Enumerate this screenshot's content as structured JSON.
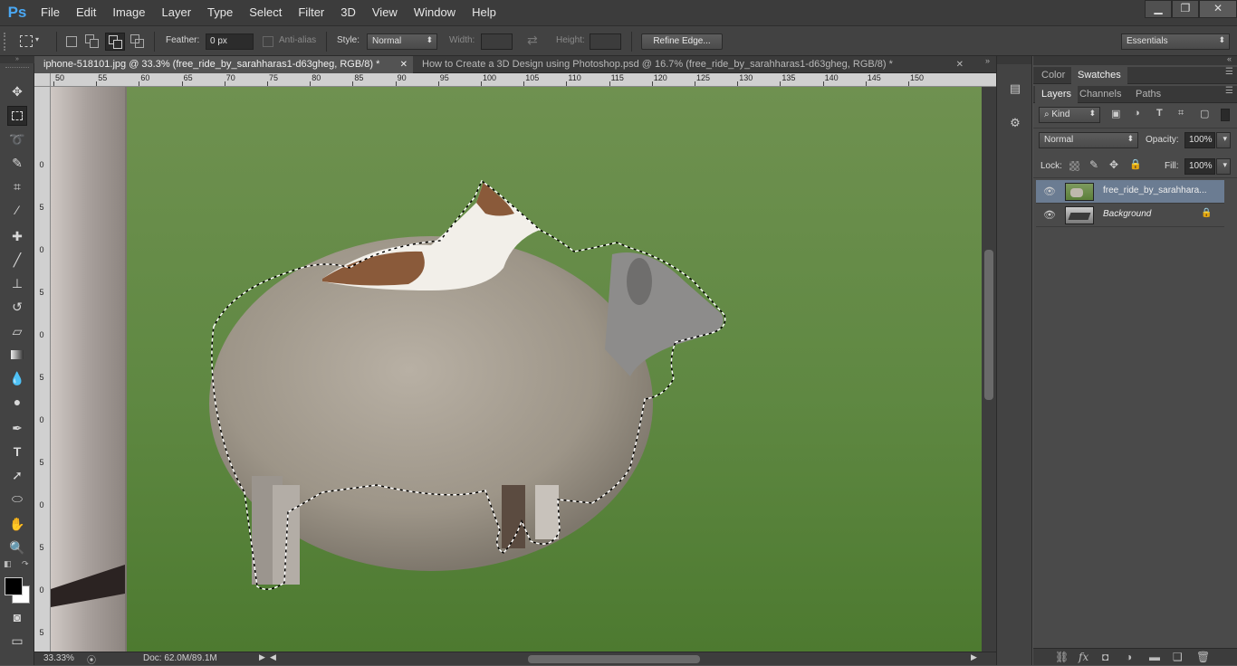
{
  "app": {
    "logo": "Ps"
  },
  "menu": [
    "File",
    "Edit",
    "Image",
    "Layer",
    "Type",
    "Select",
    "Filter",
    "3D",
    "View",
    "Window",
    "Help"
  ],
  "window_controls": {
    "minimize": "▁",
    "restore": "❐",
    "close": "✕"
  },
  "options": {
    "feather_label": "Feather:",
    "feather_value": "0 px",
    "antialias_label": "Anti-alias",
    "style_label": "Style:",
    "style_value": "Normal",
    "width_label": "Width:",
    "height_label": "Height:",
    "refine_edge_label": "Refine Edge...",
    "workspace_value": "Essentials"
  },
  "annotation": {
    "arrow_color": "#e01010"
  },
  "tabs": [
    {
      "title": "iphone-518101.jpg @ 33.3% (free_ride_by_sarahharas1-d63gheg, RGB/8) *",
      "active": true
    },
    {
      "title": "How to Create a 3D Design using Photoshop.psd @ 16.7% (free_ride_by_sarahharas1-d63gheg, RGB/8) *",
      "active": false
    }
  ],
  "ruler_h": [
    "50",
    "55",
    "60",
    "65",
    "70",
    "75",
    "80",
    "85",
    "90",
    "95",
    "100",
    "105",
    "110",
    "115",
    "120",
    "125",
    "130",
    "135",
    "140",
    "145",
    "150"
  ],
  "ruler_v": [
    "0",
    "5",
    "0",
    "5",
    "0",
    "5",
    "0",
    "5",
    "0",
    "5",
    "0",
    "5",
    "0"
  ],
  "status": {
    "zoom": "33.33%",
    "doc": "Doc: 62.0M/89.1M"
  },
  "panels": {
    "top_tabs": [
      "Color",
      "Swatches"
    ],
    "layer_tabs": [
      "Layers",
      "Channels",
      "Paths"
    ],
    "kind_label": "Kind",
    "blend_mode": "Normal",
    "opacity_label": "Opacity:",
    "opacity_value": "100%",
    "lock_label": "Lock:",
    "fill_label": "Fill:",
    "fill_value": "100%",
    "layers": [
      {
        "name": "free_ride_by_sarahhara...",
        "selected": true
      },
      {
        "name": "Background",
        "selected": false,
        "locked": true
      }
    ]
  },
  "icons": [
    "move-icon",
    "marquee-icon",
    "lasso-icon",
    "quick-select-icon",
    "crop-icon",
    "eyedropper-icon",
    "healing-icon",
    "brush-icon",
    "stamp-icon",
    "history-brush-icon",
    "eraser-icon",
    "gradient-icon",
    "blur-icon",
    "dodge-icon",
    "pen-icon",
    "type-icon",
    "path-select-icon",
    "ellipse-icon",
    "hand-icon",
    "zoom-icon"
  ]
}
